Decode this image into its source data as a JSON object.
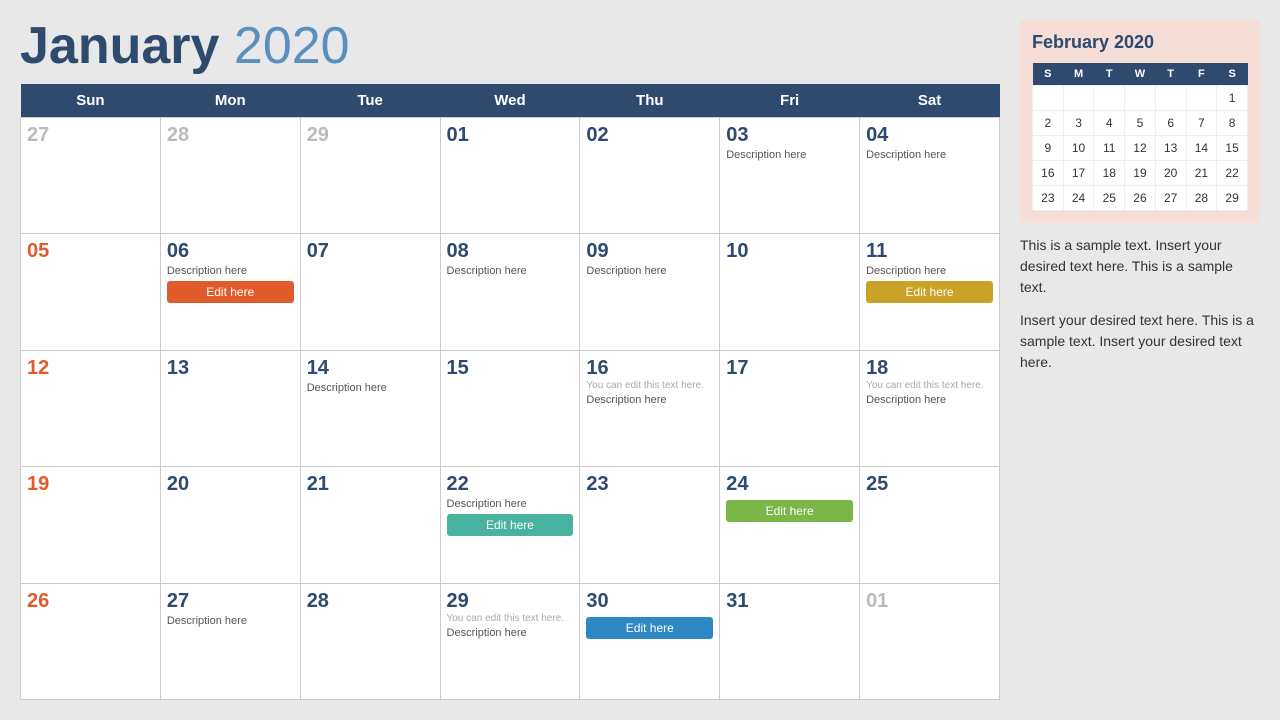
{
  "header": {
    "month": "January",
    "year": "2020"
  },
  "weekdays": [
    "Sun",
    "Mon",
    "Tue",
    "Wed",
    "Thu",
    "Fri",
    "Sat"
  ],
  "weeks": [
    [
      {
        "day": "27",
        "type": "outside",
        "desc": "",
        "hint": "",
        "btn": null
      },
      {
        "day": "28",
        "type": "outside",
        "desc": "",
        "hint": "",
        "btn": null
      },
      {
        "day": "29",
        "type": "outside",
        "desc": "",
        "hint": "",
        "btn": null
      },
      {
        "day": "01",
        "type": "current",
        "desc": "",
        "hint": "",
        "btn": null
      },
      {
        "day": "02",
        "type": "current",
        "desc": "",
        "hint": "",
        "btn": null
      },
      {
        "day": "03",
        "type": "current",
        "desc": "Description here",
        "hint": "",
        "btn": null
      },
      {
        "day": "04",
        "type": "current",
        "desc": "Description here",
        "hint": "",
        "btn": null
      }
    ],
    [
      {
        "day": "05",
        "type": "sunday",
        "desc": "",
        "hint": "",
        "btn": null
      },
      {
        "day": "06",
        "type": "current",
        "desc": "Description here",
        "hint": "",
        "btn": {
          "label": "Edit here",
          "color": "btn-orange"
        }
      },
      {
        "day": "07",
        "type": "current",
        "desc": "",
        "hint": "",
        "btn": null
      },
      {
        "day": "08",
        "type": "current",
        "desc": "Description here",
        "hint": "",
        "btn": null
      },
      {
        "day": "09",
        "type": "current",
        "desc": "Description here",
        "hint": "",
        "btn": null
      },
      {
        "day": "10",
        "type": "current",
        "desc": "",
        "hint": "",
        "btn": null
      },
      {
        "day": "11",
        "type": "current",
        "desc": "Description here",
        "hint": "",
        "btn": {
          "label": "Edit here",
          "color": "btn-gold"
        }
      }
    ],
    [
      {
        "day": "12",
        "type": "sunday",
        "desc": "",
        "hint": "",
        "btn": null
      },
      {
        "day": "13",
        "type": "current",
        "desc": "",
        "hint": "",
        "btn": null
      },
      {
        "day": "14",
        "type": "current",
        "desc": "Description here",
        "hint": "",
        "btn": null
      },
      {
        "day": "15",
        "type": "current",
        "desc": "",
        "hint": "",
        "btn": null
      },
      {
        "day": "16",
        "type": "current",
        "desc": "Description here",
        "hint": "You can edit this text here.",
        "btn": null
      },
      {
        "day": "17",
        "type": "current",
        "desc": "",
        "hint": "",
        "btn": null
      },
      {
        "day": "18",
        "type": "current",
        "desc": "Description here",
        "hint": "You can edit this text here.",
        "btn": null
      }
    ],
    [
      {
        "day": "19",
        "type": "sunday",
        "desc": "",
        "hint": "",
        "btn": null
      },
      {
        "day": "20",
        "type": "current",
        "desc": "",
        "hint": "",
        "btn": null
      },
      {
        "day": "21",
        "type": "current",
        "desc": "",
        "hint": "",
        "btn": null
      },
      {
        "day": "22",
        "type": "current",
        "desc": "Description here",
        "hint": "",
        "btn": {
          "label": "Edit here",
          "color": "btn-teal"
        }
      },
      {
        "day": "23",
        "type": "current",
        "desc": "",
        "hint": "",
        "btn": null
      },
      {
        "day": "24",
        "type": "current",
        "desc": "",
        "hint": "",
        "btn": {
          "label": "Edit here",
          "color": "btn-green"
        }
      },
      {
        "day": "25",
        "type": "current",
        "desc": "",
        "hint": "",
        "btn": null
      }
    ],
    [
      {
        "day": "26",
        "type": "sunday",
        "desc": "",
        "hint": "",
        "btn": null
      },
      {
        "day": "27",
        "type": "current",
        "desc": "Description here",
        "hint": "",
        "btn": null
      },
      {
        "day": "28",
        "type": "current",
        "desc": "",
        "hint": "",
        "btn": null
      },
      {
        "day": "29",
        "type": "current",
        "desc": "Description here",
        "hint": "You can edit this text here.",
        "btn": null
      },
      {
        "day": "30",
        "type": "current",
        "desc": "",
        "hint": "",
        "btn": {
          "label": "Edit here",
          "color": "btn-blue"
        }
      },
      {
        "day": "31",
        "type": "current",
        "desc": "",
        "hint": "",
        "btn": null
      },
      {
        "day": "01",
        "type": "outside",
        "desc": "",
        "hint": "",
        "btn": null
      }
    ]
  ],
  "sidebar": {
    "mini_cal_title": "February 2020",
    "mini_weekdays": [
      "S",
      "M",
      "T",
      "W",
      "T",
      "F",
      "S"
    ],
    "mini_weeks": [
      [
        "",
        "",
        "",
        "",
        "",
        "",
        "1"
      ],
      [
        "2",
        "3",
        "4",
        "5",
        "6",
        "7",
        "8"
      ],
      [
        "9",
        "10",
        "11",
        "12",
        "13",
        "14",
        "15"
      ],
      [
        "16",
        "17",
        "18",
        "19",
        "20",
        "21",
        "22"
      ],
      [
        "23",
        "24",
        "25",
        "26",
        "27",
        "28",
        "29"
      ]
    ],
    "text1": "This is a sample text. Insert your desired text here. This is a sample text.",
    "text2": "Insert your desired text here. This is a sample text. Insert your desired text here."
  }
}
